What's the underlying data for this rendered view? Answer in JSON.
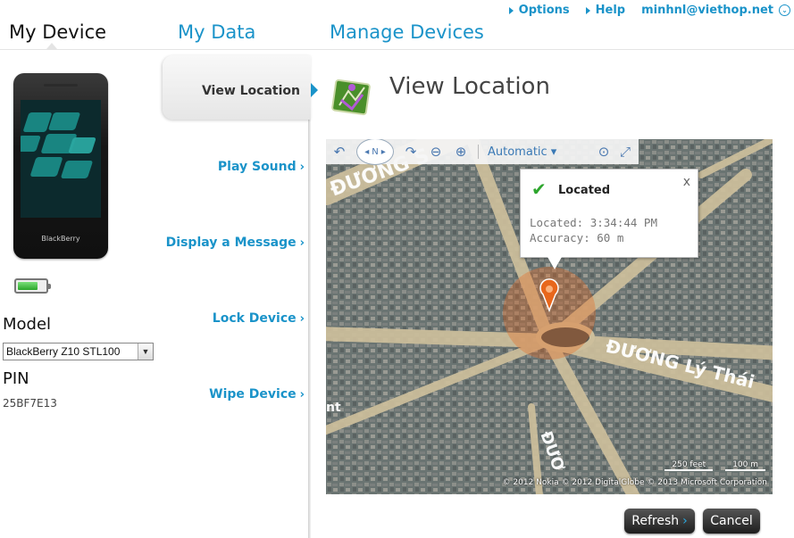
{
  "top_links": {
    "options": "Options",
    "help": "Help",
    "user": "minhnl@viethop.net"
  },
  "nav": {
    "tabs": [
      {
        "label": "My Device",
        "active": true
      },
      {
        "label": "My Data",
        "active": false
      },
      {
        "label": "Manage Devices",
        "active": false
      }
    ]
  },
  "device": {
    "brand": "BlackBerry",
    "battery_level": 0.65,
    "model_label": "Model",
    "model_value": "BlackBerry Z10 STL100",
    "pin_label": "PIN",
    "pin_value": "25BF7E13"
  },
  "actions": {
    "active": "View Location",
    "items": [
      {
        "label": "Play Sound"
      },
      {
        "label": "Display a Message"
      },
      {
        "label": "Lock Device"
      },
      {
        "label": "Wipe Device"
      }
    ]
  },
  "panel": {
    "title": "View Location"
  },
  "map": {
    "toolbar_mode": "Automatic",
    "compass_label": "N",
    "popup": {
      "title": "Located",
      "close": "x",
      "located": "Located: 3:34:44 PM",
      "accuracy": "Accuracy: 60 m"
    },
    "street_labels": [
      "ĐƯƠNG S",
      "ĐƯƠNG Lý Thái",
      "ĐƯƠ",
      "nt"
    ],
    "scale_feet": "250 feet",
    "scale_m": "100 m",
    "copyright": "© 2012 Nokia   © 2012 DigitalGlobe   © 2013 Microsoft Corporation"
  },
  "buttons": {
    "refresh": "Refresh",
    "cancel": "Cancel"
  },
  "colors": {
    "accent": "#1a93c9",
    "pin": "#e8671c"
  }
}
